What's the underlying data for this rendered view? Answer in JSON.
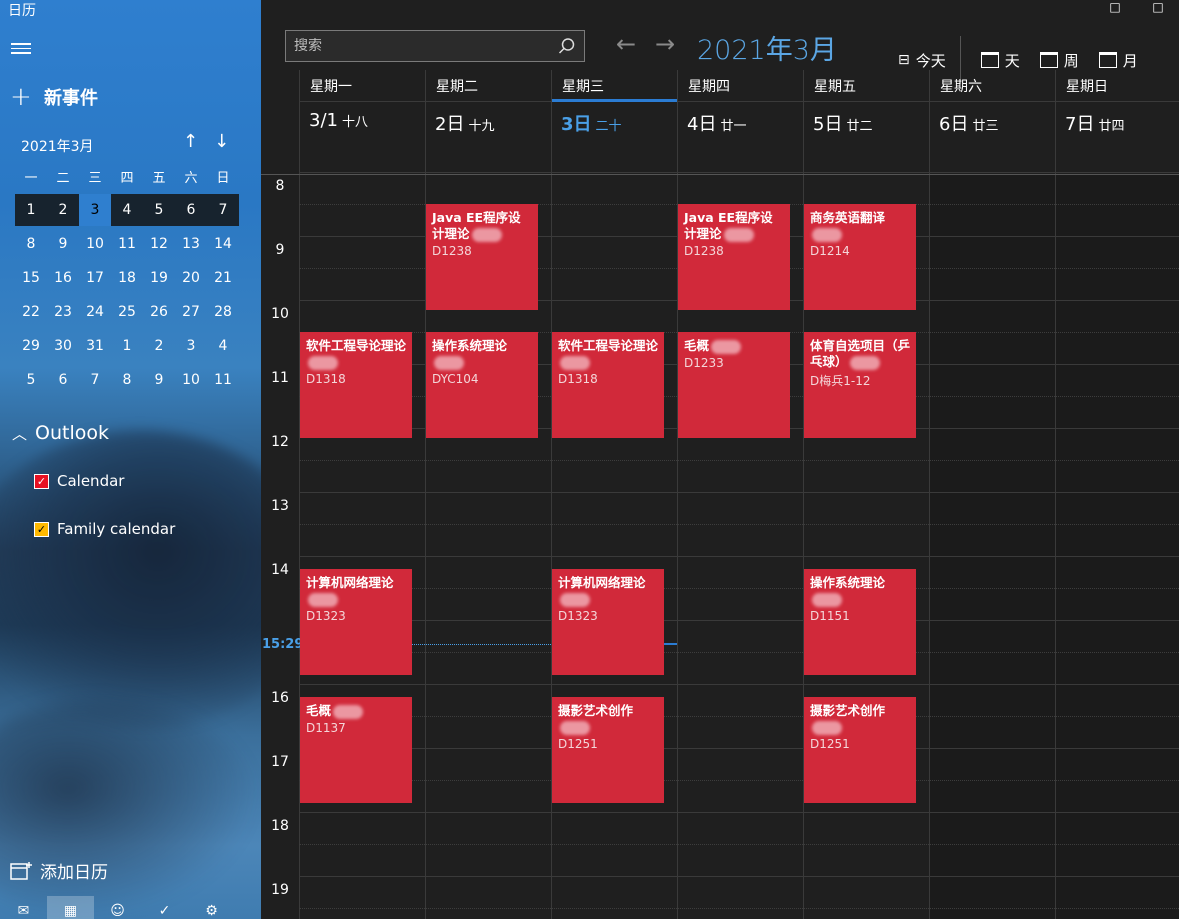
{
  "app": {
    "title": "日历"
  },
  "sidebar": {
    "new_event": "新事件",
    "mini_calendar": {
      "month": "2021年3月",
      "weekdays": [
        "一",
        "二",
        "三",
        "四",
        "五",
        "六",
        "日"
      ],
      "weeks": [
        [
          "1",
          "2",
          "3",
          "4",
          "5",
          "6",
          "7"
        ],
        [
          "8",
          "9",
          "10",
          "11",
          "12",
          "13",
          "14"
        ],
        [
          "15",
          "16",
          "17",
          "18",
          "19",
          "20",
          "21"
        ],
        [
          "22",
          "23",
          "24",
          "25",
          "26",
          "27",
          "28"
        ],
        [
          "29",
          "30",
          "31",
          "1",
          "2",
          "3",
          "4"
        ],
        [
          "5",
          "6",
          "7",
          "8",
          "9",
          "10",
          "11"
        ]
      ],
      "selected_week": 0,
      "today_index": 2
    },
    "outlook": {
      "label": "Outlook"
    },
    "calendars": [
      {
        "label": "Calendar",
        "color": "#e81123",
        "checked": true
      },
      {
        "label": "Family calendar",
        "color": "#ffb900",
        "checked": true
      }
    ],
    "add_calendar": "添加日历"
  },
  "header": {
    "search_placeholder": "搜索",
    "month_title": "2021年3月",
    "toolbar": {
      "today": "今天",
      "day": "天",
      "week": "周",
      "month": "月"
    }
  },
  "days": [
    {
      "name": "星期一",
      "date": "3/1",
      "lunar": "十八"
    },
    {
      "name": "星期二",
      "date": "2日",
      "lunar": "十九"
    },
    {
      "name": "星期三",
      "date": "3日",
      "lunar": "二十",
      "today": true
    },
    {
      "name": "星期四",
      "date": "4日",
      "lunar": "廿一"
    },
    {
      "name": "星期五",
      "date": "5日",
      "lunar": "廿二"
    },
    {
      "name": "星期六",
      "date": "6日",
      "lunar": "廿三"
    },
    {
      "name": "星期日",
      "date": "7日",
      "lunar": "廿四"
    }
  ],
  "hours": [
    "8",
    "9",
    "10",
    "11",
    "12",
    "13",
    "14",
    "15:29",
    "16",
    "17",
    "18",
    "19"
  ],
  "current_time": "15:29",
  "events": [
    {
      "day": 1,
      "start": 8.5,
      "end": 10.15,
      "title": "Java EE程序设计理论",
      "room": "D1238"
    },
    {
      "day": 3,
      "start": 8.5,
      "end": 10.15,
      "title": "Java EE程序设计理论",
      "room": "D1238"
    },
    {
      "day": 4,
      "start": 8.5,
      "end": 10.15,
      "title": "商务英语翻译",
      "room": "D1214"
    },
    {
      "day": 0,
      "start": 10.5,
      "end": 12.15,
      "title": "软件工程导论理论",
      "room": "D1318"
    },
    {
      "day": 1,
      "start": 10.5,
      "end": 12.15,
      "title": "操作系统理论",
      "room": "DYC104"
    },
    {
      "day": 2,
      "start": 10.5,
      "end": 12.15,
      "title": "软件工程导论理论",
      "room": "D1318"
    },
    {
      "day": 3,
      "start": 10.5,
      "end": 12.15,
      "title": "毛概",
      "room": "D1233"
    },
    {
      "day": 4,
      "start": 10.5,
      "end": 12.15,
      "title": "体育自选项目（乒乓球）",
      "room": "D梅兵1-12"
    },
    {
      "day": 0,
      "start": 14.2,
      "end": 15.85,
      "title": "计算机网络理论",
      "room": "D1323"
    },
    {
      "day": 2,
      "start": 14.2,
      "end": 15.85,
      "title": "计算机网络理论",
      "room": "D1323"
    },
    {
      "day": 4,
      "start": 14.2,
      "end": 15.85,
      "title": "操作系统理论",
      "room": "D1151"
    },
    {
      "day": 0,
      "start": 16.2,
      "end": 17.85,
      "title": "毛概",
      "room": "D1137"
    },
    {
      "day": 2,
      "start": 16.2,
      "end": 17.85,
      "title": "摄影艺术创作",
      "room": "D1251"
    },
    {
      "day": 4,
      "start": 16.2,
      "end": 17.85,
      "title": "摄影艺术创作",
      "room": "D1251"
    }
  ]
}
